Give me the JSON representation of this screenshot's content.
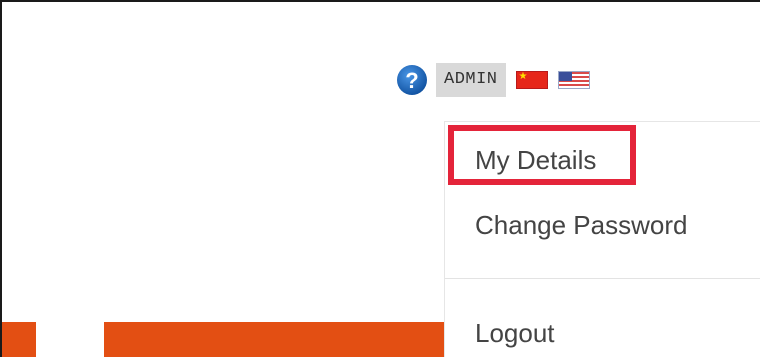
{
  "header": {
    "admin_label": "ADMIN",
    "help_icon": "help-question-icon",
    "flags": [
      {
        "name": "china-flag-icon",
        "colors": [
          "#e6261a",
          "#ffde00"
        ]
      },
      {
        "name": "us-flag-icon",
        "colors": [
          "#d94a4a",
          "#ffffff",
          "#3a4f9a"
        ]
      }
    ]
  },
  "dropdown": {
    "items": [
      {
        "label": "My Details",
        "highlighted": true
      },
      {
        "label": "Change Password",
        "highlighted": false
      },
      {
        "label": "Logout",
        "highlighted": false
      }
    ]
  },
  "colors": {
    "accent_orange": "#e34f13",
    "highlight_red": "#e4243a",
    "help_blue": "#1a64b8"
  }
}
